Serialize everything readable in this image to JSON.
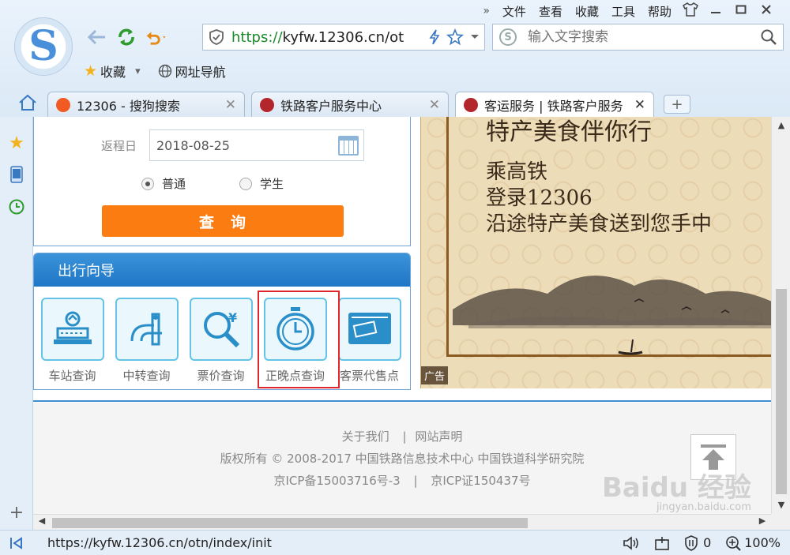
{
  "menu": {
    "chevrons": "»",
    "file": "文件",
    "view": "查看",
    "favorites": "收藏",
    "tools": "工具",
    "help": "帮助"
  },
  "address": {
    "scheme": "https://",
    "host": "kyfw.12306.cn/ot"
  },
  "search": {
    "placeholder": "输入文字搜索",
    "engine_letter": "S"
  },
  "bookmarks": {
    "favorites_label": "收藏",
    "favorites_arrow": "▾",
    "nav_label": "网址导航"
  },
  "tabs": [
    {
      "label": "12306 - 搜狗搜索",
      "icon_color": "#f15a22"
    },
    {
      "label": "铁路客户服务中心",
      "icon_color": "#b3262b"
    },
    {
      "label": "客运服务 | 铁路客户服务",
      "icon_color": "#b3262b"
    }
  ],
  "tab_close": "✕",
  "newtab_label": "+",
  "sidebar_add": "+",
  "query": {
    "return_date_label": "返程日",
    "return_date_value": "2018-08-25",
    "ticket_type_normal": "普通",
    "ticket_type_student": "学生",
    "selected_ticket_type": "普通",
    "search_button": "查　询"
  },
  "guide": {
    "title": "出行向导",
    "items": [
      {
        "label": "车站查询",
        "icon": "station-icon"
      },
      {
        "label": "中转查询",
        "icon": "transfer-icon"
      },
      {
        "label": "票价查询",
        "icon": "fare-icon"
      },
      {
        "label": "正晚点查询",
        "icon": "clock-icon"
      },
      {
        "label": "客票代售点",
        "icon": "ticket-agency-icon"
      }
    ]
  },
  "ad": {
    "top_line": "特产美食伴你行",
    "lines": [
      "乘高铁",
      "登录12306",
      "沿途特产美食送到您手中"
    ],
    "label": "广告"
  },
  "footer": {
    "about": "关于我们",
    "separator": "|",
    "statement": "网站声明",
    "copyright": "版权所有 © 2008-2017 中国铁路信息技术中心 中国铁道科学研究院",
    "icp_bei": "京ICP备15003716号-3",
    "icp_zheng": "京ICP证150437号"
  },
  "watermark": {
    "main": "Baidu 经验",
    "sub": "jingyan.baidu.com"
  },
  "status": {
    "url": "https://kyfw.12306.cn/otn/index/init",
    "blocked_count": "0",
    "zoom": "100%"
  },
  "colors": {
    "accent_orange": "#fb7d12",
    "guide_blue": "#1f77c7",
    "highlight_red": "#e0272c",
    "icon_cyan": "#64c3e6"
  }
}
